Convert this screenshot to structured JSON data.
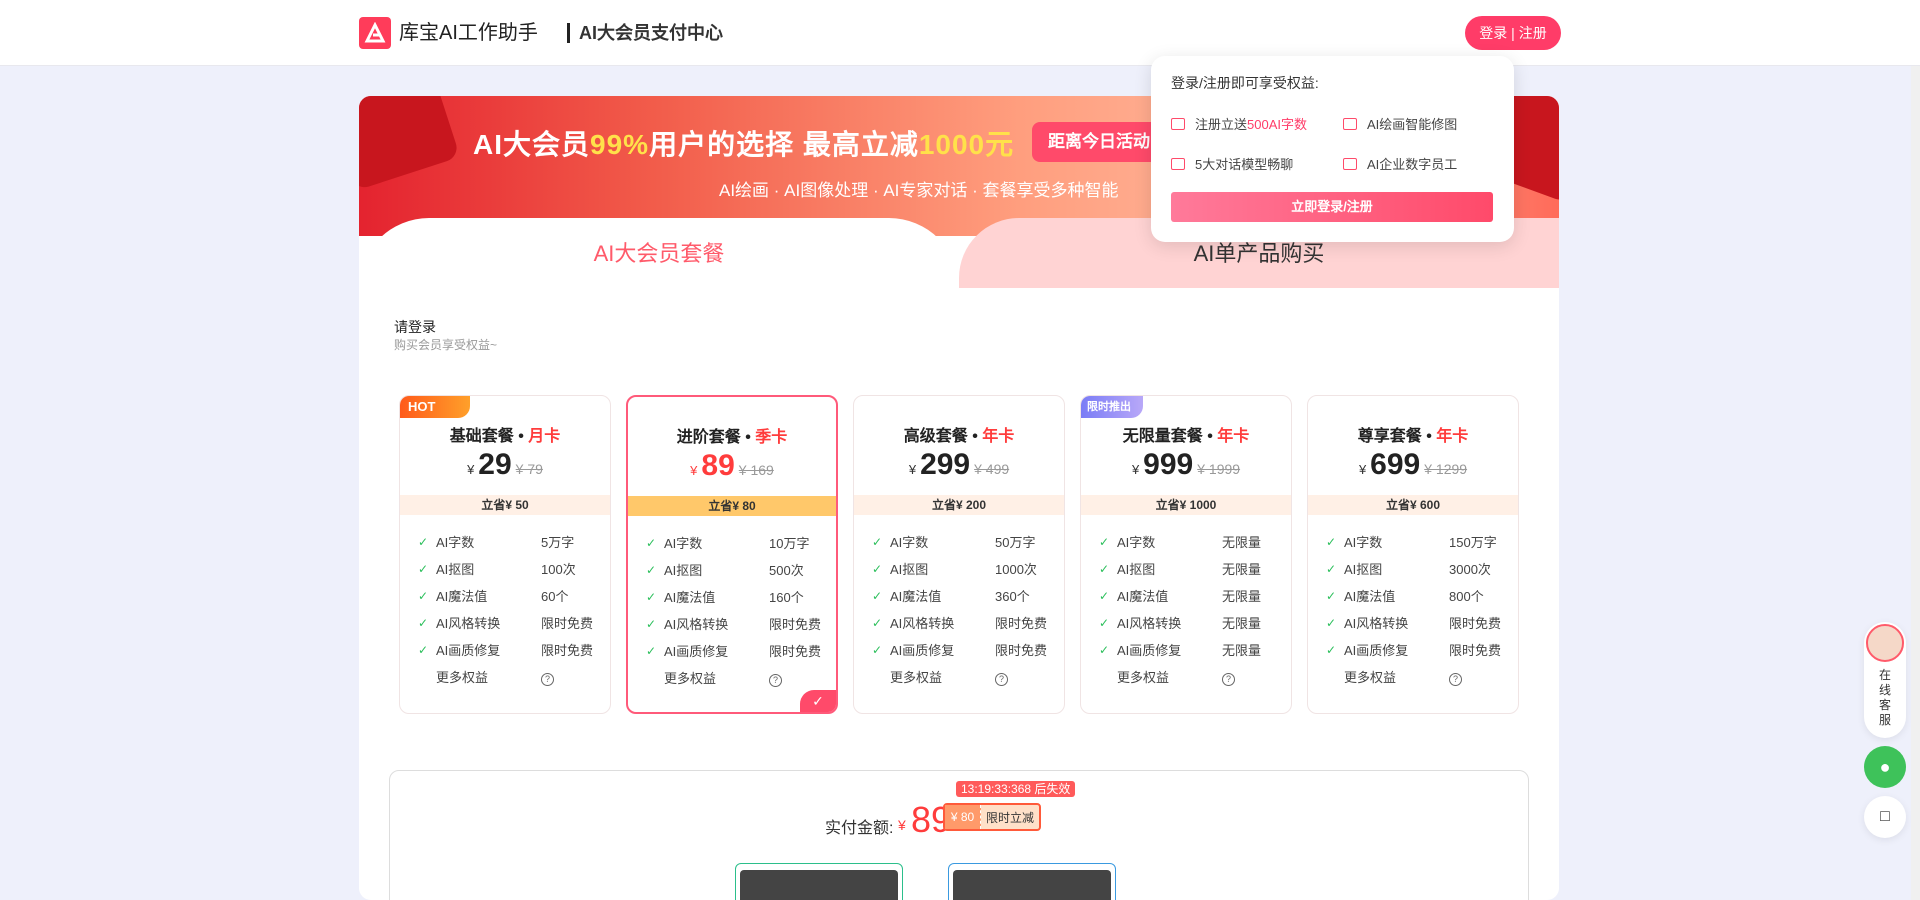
{
  "header": {
    "brand": "库宝AI工作助手",
    "subtitle": "AI大会员支付中心",
    "login_button": "登录 | 注册"
  },
  "banner": {
    "title_prefix": "AI大会员",
    "title_highlight": "99%",
    "title_mid": "用户的选择 最高立减",
    "title_highlight2": "1000元",
    "subtitle": "AI绘画 · AI图像处理 · AI专家对话 · 套餐享受多种智能",
    "countdown": "距离今日活动"
  },
  "tabs": {
    "left": "AI大会员套餐",
    "right": "AI单产品购买"
  },
  "login_hint": {
    "title": "请登录",
    "sub": "购买会员享受权益~"
  },
  "plans": [
    {
      "name": "基础套餐",
      "period": "月卡",
      "currency": "¥",
      "price": "29",
      "original": "¥ 79",
      "save": "立省¥ 50",
      "tag": "HOT",
      "features": [
        [
          "AI字数",
          "5万字"
        ],
        [
          "AI抠图",
          "100次"
        ],
        [
          "AI魔法值",
          "60个"
        ],
        [
          "AI风格转换",
          "限时免费"
        ],
        [
          "AI画质修复",
          "限时免费"
        ]
      ]
    },
    {
      "name": "进阶套餐",
      "period": "季卡",
      "currency": "¥",
      "price": "89",
      "original": "¥ 169",
      "save": "立省¥ 80",
      "tag": "",
      "features": [
        [
          "AI字数",
          "10万字"
        ],
        [
          "AI抠图",
          "500次"
        ],
        [
          "AI魔法值",
          "160个"
        ],
        [
          "AI风格转换",
          "限时免费"
        ],
        [
          "AI画质修复",
          "限时免费"
        ]
      ]
    },
    {
      "name": "高级套餐",
      "period": "年卡",
      "currency": "¥",
      "price": "299",
      "original": "¥ 499",
      "save": "立省¥ 200",
      "tag": "",
      "features": [
        [
          "AI字数",
          "50万字"
        ],
        [
          "AI抠图",
          "1000次"
        ],
        [
          "AI魔法值",
          "360个"
        ],
        [
          "AI风格转换",
          "限时免费"
        ],
        [
          "AI画质修复",
          "限时免费"
        ]
      ]
    },
    {
      "name": "无限量套餐",
      "period": "年卡",
      "currency": "¥",
      "price": "999",
      "original": "¥ 1999",
      "save": "立省¥ 1000",
      "tag": "限时推出",
      "features": [
        [
          "AI字数",
          "无限量"
        ],
        [
          "AI抠图",
          "无限量"
        ],
        [
          "AI魔法值",
          "无限量"
        ],
        [
          "AI风格转换",
          "无限量"
        ],
        [
          "AI画质修复",
          "无限量"
        ]
      ]
    },
    {
      "name": "尊享套餐",
      "period": "年卡",
      "currency": "¥",
      "price": "699",
      "original": "¥ 1299",
      "save": "立省¥ 600",
      "tag": "",
      "features": [
        [
          "AI字数",
          "150万字"
        ],
        [
          "AI抠图",
          "3000次"
        ],
        [
          "AI魔法值",
          "800个"
        ],
        [
          "AI风格转换",
          "限时免费"
        ],
        [
          "AI画质修复",
          "限时免费"
        ]
      ]
    }
  ],
  "more_label": "更多权益",
  "payment": {
    "label": "实付金额:",
    "currency": "¥",
    "amount": "89",
    "timer": "13:19:33:368 后失效",
    "discount_amount": "¥ 80",
    "discount_label": "限时立减"
  },
  "popup": {
    "title": "登录/注册即可享受权益:",
    "perk1_prefix": "注册立送",
    "perk1_highlight": "500AI字数",
    "perk2": "AI绘画智能修图",
    "perk3": "5大对话模型畅聊",
    "perk4": "AI企业数字员工",
    "button": "立即登录/注册"
  },
  "side": {
    "service": "在线客服"
  },
  "colors": {
    "accent": "#ff3c68",
    "price_red": "#ff3c3c"
  }
}
